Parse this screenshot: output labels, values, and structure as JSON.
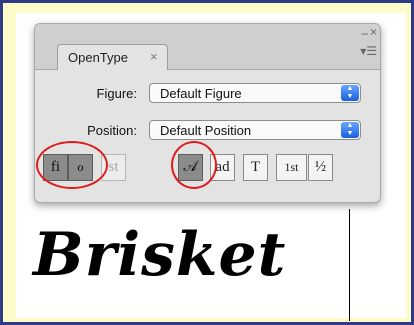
{
  "panel": {
    "tab_label": "OpenType",
    "tab_close": "×",
    "minimize": "–",
    "close": "×",
    "menu": "▾☰"
  },
  "rows": {
    "figure": {
      "label": "Figure:",
      "value": "Default Figure"
    },
    "position": {
      "label": "Position:",
      "value": "Default Position"
    }
  },
  "feature_buttons": [
    {
      "name": "standard-ligatures",
      "glyph": "fi",
      "state": "on"
    },
    {
      "name": "contextual-alternates",
      "glyph": "ℴ",
      "state": "on"
    },
    {
      "name": "discretionary-ligatures",
      "glyph": "st",
      "state": "disabled"
    },
    {
      "name": "swash",
      "glyph": "𝒜",
      "state": "on"
    },
    {
      "name": "stylistic-alternates",
      "glyph": "ad",
      "state": "off"
    },
    {
      "name": "titling-alternates",
      "glyph": "T",
      "state": "off"
    },
    {
      "name": "ordinals",
      "glyph": "1st",
      "state": "off"
    },
    {
      "name": "fractions",
      "glyph": "½",
      "state": "off"
    }
  ],
  "document": {
    "sample_text": "Brisket"
  },
  "colors": {
    "frame_border": "#2e3b85",
    "frame_bg": "#fdfbc9",
    "highlight_ring": "#dd1e1e"
  }
}
